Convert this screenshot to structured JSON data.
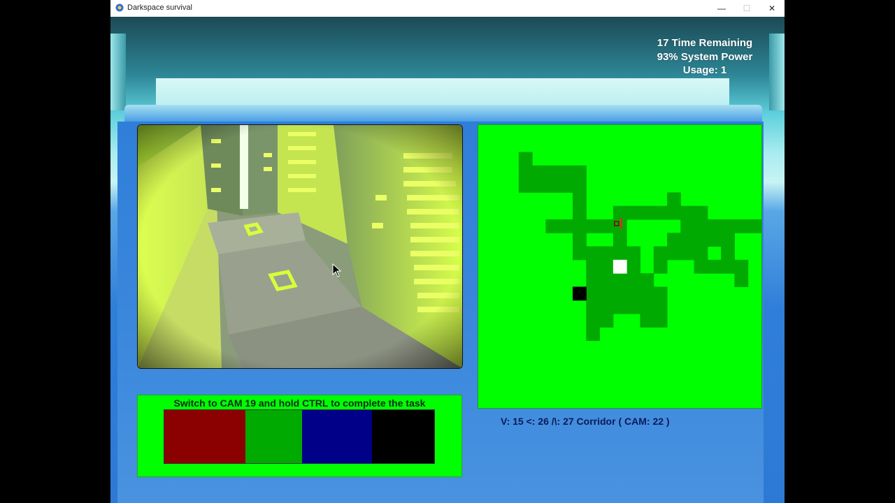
{
  "window": {
    "title": "Darkspace survival",
    "controls": {
      "minimize": "—",
      "maximize": "☐",
      "close": "✕"
    }
  },
  "hud": {
    "time_remaining": "17 Time Remaining",
    "system_power": "93% System Power",
    "usage": "Usage: 1"
  },
  "camera": {
    "info": "V: 15 <: 26 /\\: 27 Corridor ( CAM: 22 )"
  },
  "task": {
    "instruction": "Switch to CAM 19 and hold CTRL to complete the task",
    "swatches": [
      {
        "name": "red",
        "color": "#8b0000",
        "share": 0.3
      },
      {
        "name": "green",
        "color": "#00aa00",
        "share": 0.21
      },
      {
        "name": "blue",
        "color": "#000088",
        "share": 0.26
      },
      {
        "name": "black",
        "color": "#000000",
        "share": 0.23
      }
    ]
  },
  "map": {
    "background": "#00ff00",
    "corridor_color": "#00aa00",
    "grid_cols": 21,
    "grid_rows": 21,
    "corridor_cells": [
      [
        3,
        2
      ],
      [
        3,
        3
      ],
      [
        4,
        3
      ],
      [
        5,
        3
      ],
      [
        6,
        3
      ],
      [
        3,
        4
      ],
      [
        4,
        4
      ],
      [
        5,
        4
      ],
      [
        6,
        4
      ],
      [
        7,
        3
      ],
      [
        7,
        4
      ],
      [
        7,
        5
      ],
      [
        7,
        6
      ],
      [
        5,
        7
      ],
      [
        6,
        7
      ],
      [
        7,
        7
      ],
      [
        8,
        7
      ],
      [
        9,
        7
      ],
      [
        10,
        7
      ],
      [
        10,
        6
      ],
      [
        11,
        6
      ],
      [
        12,
        6
      ],
      [
        13,
        6
      ],
      [
        14,
        6
      ],
      [
        15,
        6
      ],
      [
        16,
        6
      ],
      [
        14,
        5
      ],
      [
        15,
        7
      ],
      [
        16,
        7
      ],
      [
        17,
        7
      ],
      [
        18,
        7
      ],
      [
        19,
        7
      ],
      [
        20,
        7
      ],
      [
        14,
        8
      ],
      [
        15,
        8
      ],
      [
        16,
        8
      ],
      [
        17,
        8
      ],
      [
        18,
        8
      ],
      [
        13,
        9
      ],
      [
        14,
        9
      ],
      [
        15,
        9
      ],
      [
        16,
        9
      ],
      [
        18,
        9
      ],
      [
        13,
        10
      ],
      [
        16,
        10
      ],
      [
        17,
        10
      ],
      [
        18,
        10
      ],
      [
        19,
        10
      ],
      [
        19,
        11
      ],
      [
        7,
        8
      ],
      [
        7,
        9
      ],
      [
        8,
        9
      ],
      [
        9,
        9
      ],
      [
        10,
        9
      ],
      [
        11,
        9
      ],
      [
        10,
        8
      ],
      [
        8,
        10
      ],
      [
        9,
        10
      ],
      [
        10,
        10
      ],
      [
        11,
        10
      ],
      [
        8,
        11
      ],
      [
        9,
        11
      ],
      [
        10,
        11
      ],
      [
        11,
        11
      ],
      [
        12,
        11
      ],
      [
        8,
        12
      ],
      [
        9,
        12
      ],
      [
        10,
        12
      ],
      [
        11,
        12
      ],
      [
        12,
        12
      ],
      [
        13,
        12
      ],
      [
        8,
        13
      ],
      [
        9,
        13
      ],
      [
        10,
        13
      ],
      [
        11,
        13
      ],
      [
        12,
        13
      ],
      [
        13,
        13
      ],
      [
        8,
        14
      ],
      [
        9,
        14
      ],
      [
        12,
        14
      ],
      [
        13,
        14
      ],
      [
        8,
        15
      ]
    ],
    "white_cell": [
      10,
      10
    ],
    "black_cell": [
      7,
      12
    ],
    "marker_cell": [
      10,
      7
    ]
  }
}
